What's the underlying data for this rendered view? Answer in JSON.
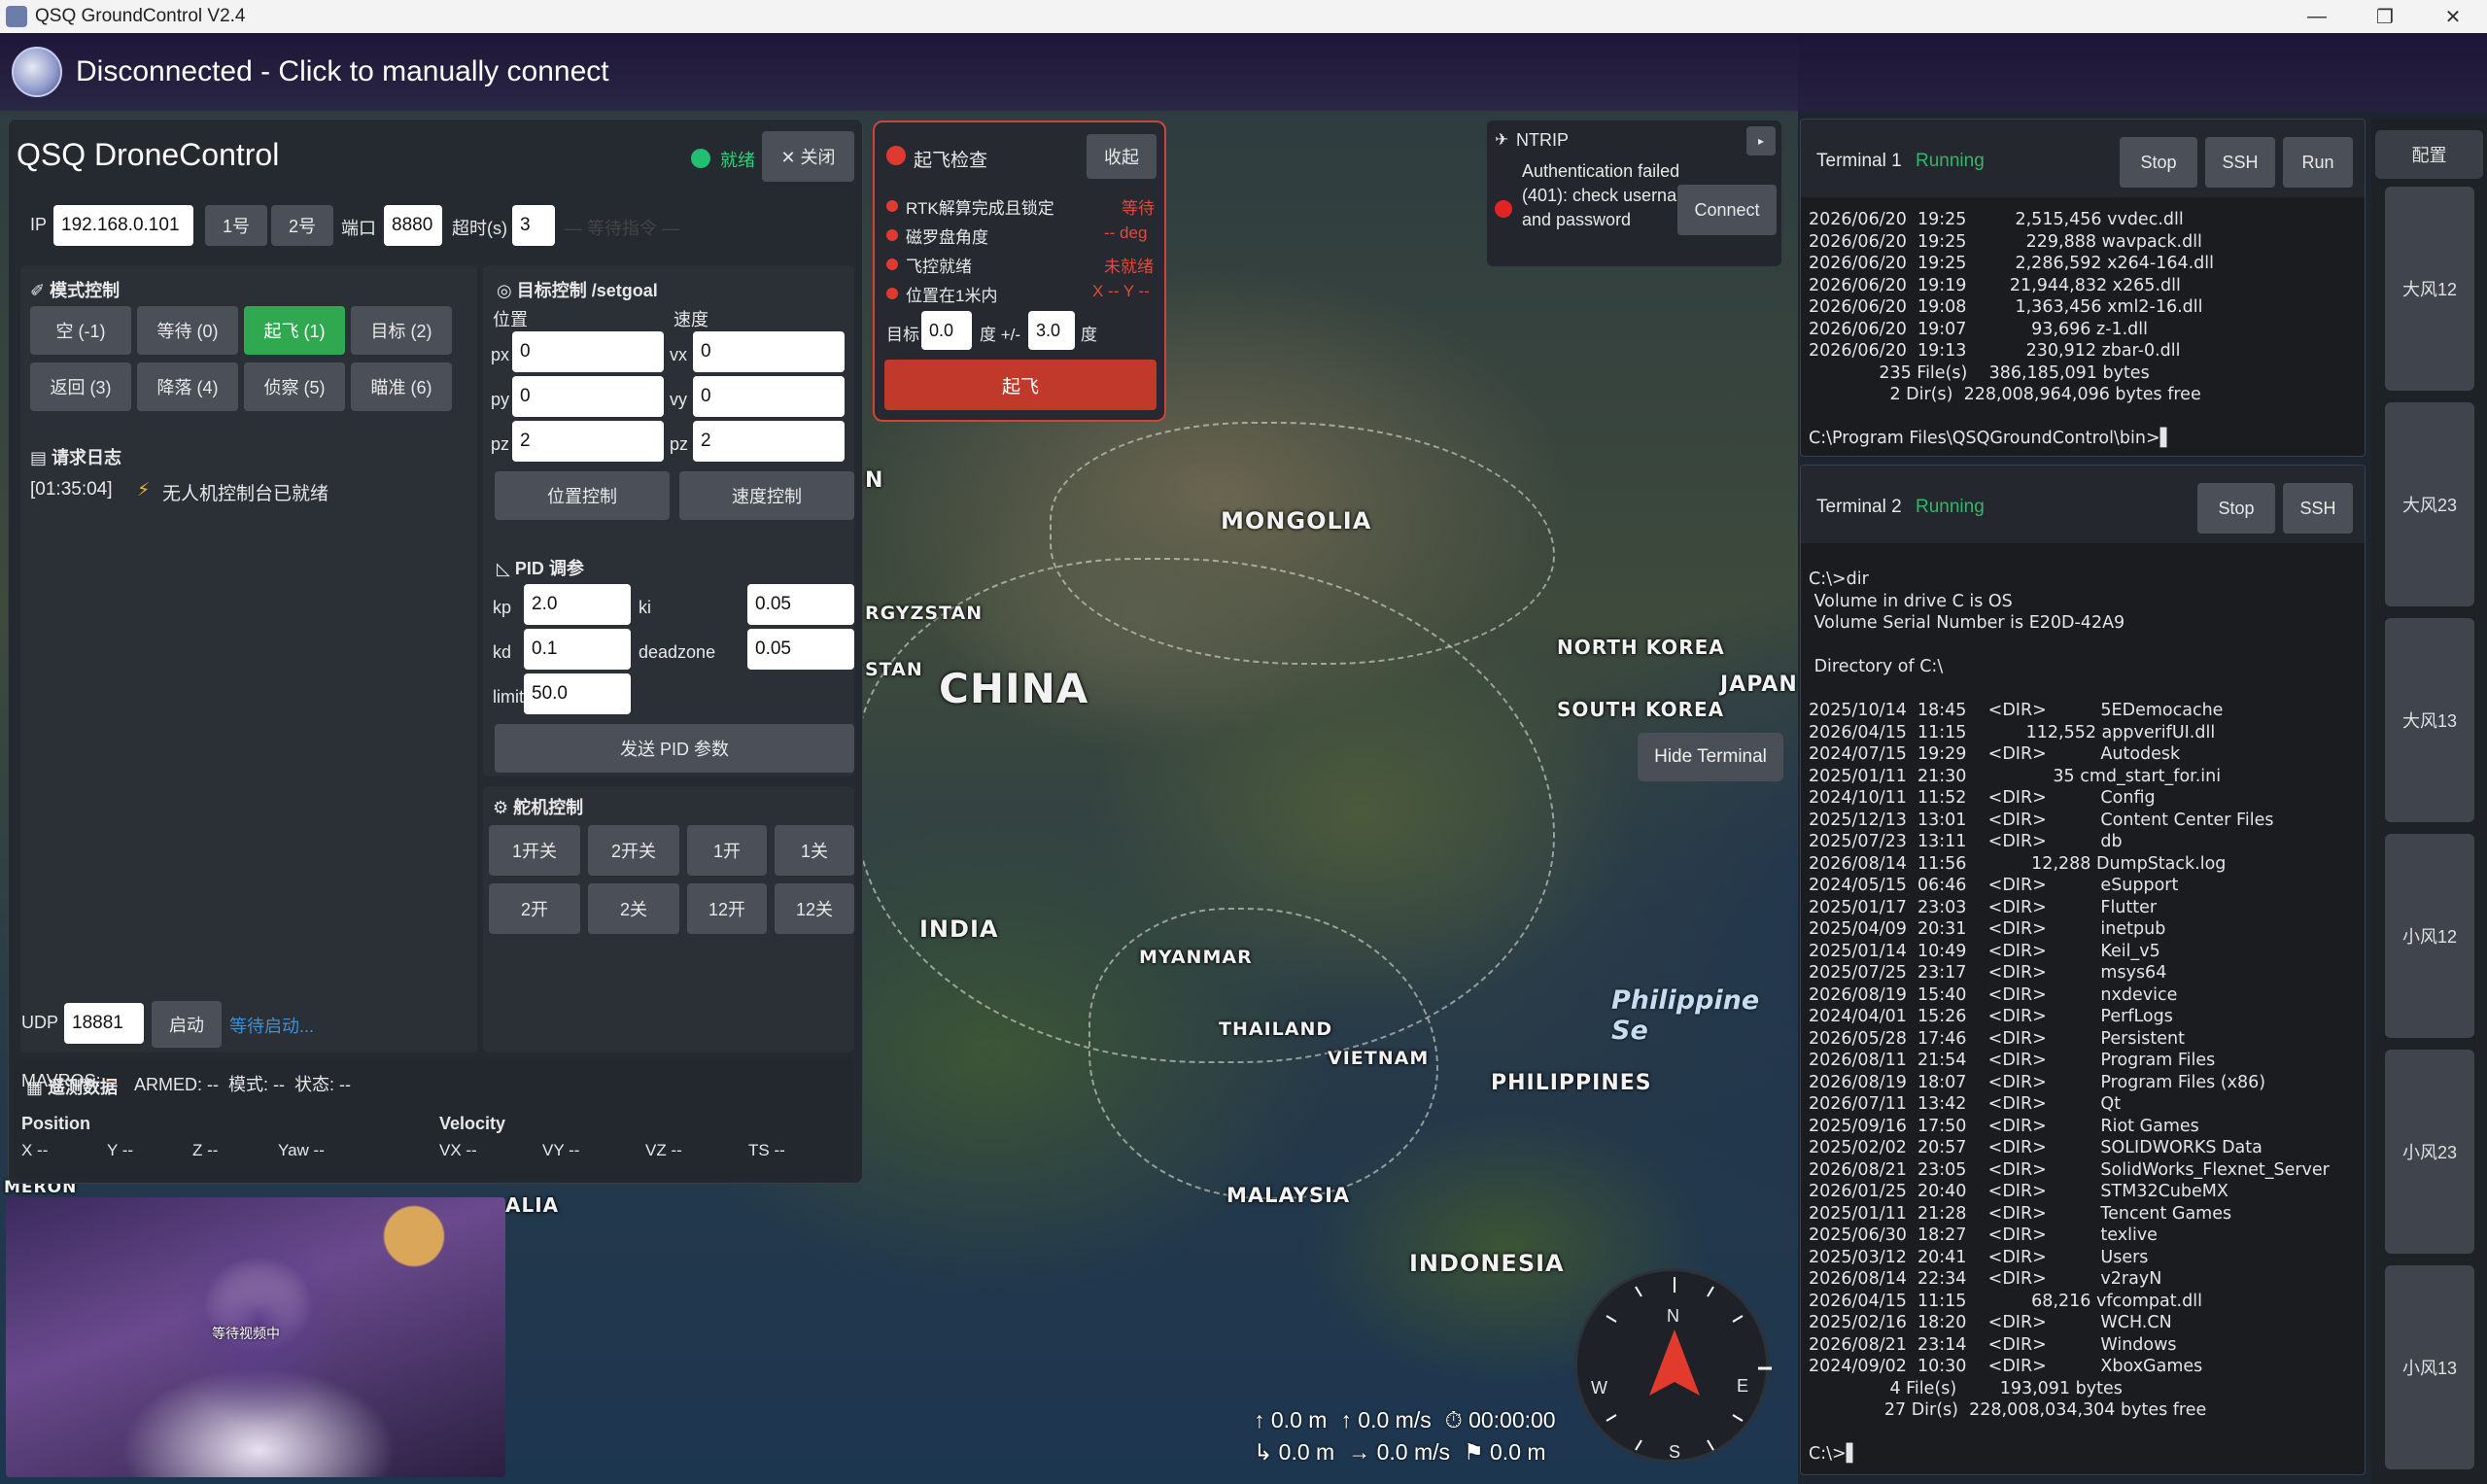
{
  "window": {
    "title": "QSQ GroundControl V2.4",
    "minimize": "—",
    "maximize": "❐",
    "close": "✕"
  },
  "banner": {
    "status": "Disconnected - Click to manually connect"
  },
  "map": {
    "labels": [
      "MONGOLIA",
      "CHINA",
      "NORTH KOREA",
      "SOUTH KOREA",
      "JAPAN",
      "INDIA",
      "MYANMAR",
      "THAILAND",
      "VIETNAM",
      "PHILIPPINES",
      "MALAYSIA",
      "INDONESIA",
      "RGYZSTAN",
      "STAN",
      "N",
      "ALIA",
      "MERON"
    ],
    "sea": "Philippine Se"
  },
  "drone_control": {
    "title": "QSQ DroneControl",
    "status": "就绪",
    "close_label": "✕ 关闭",
    "ip_label": "IP",
    "ip_value": "192.168.0.101",
    "drone1": "1号",
    "drone2": "2号",
    "port_label": "端口",
    "port_value": "8880",
    "timeout_label": "超时(s)",
    "timeout_value": "3",
    "waiting_cmd": "— 等待指令 —",
    "mode_section": "模式控制",
    "modes": [
      "空 (-1)",
      "等待 (0)",
      "起飞 (1)",
      "目标 (2)",
      "返回 (3)",
      "降落 (4)",
      "侦察 (5)",
      "瞄准 (6)"
    ],
    "log_section": "请求日志",
    "log_time": "[01:35:04]",
    "log_text": "无人机控制台已就绪",
    "target_section": "目标控制 /setgoal",
    "pos_label": "位置",
    "vel_label": "速度",
    "px_label": "px",
    "px_value": "0",
    "py_label": "py",
    "py_value": "0",
    "pz_label": "pz",
    "pz_value": "2",
    "vx_label": "vx",
    "vx_value": "0",
    "vy_label": "vy",
    "vy_value": "0",
    "vz_label": "pz",
    "vz_value": "2",
    "pos_ctrl": "位置控制",
    "vel_ctrl": "速度控制",
    "pid_section": "PID 调参",
    "kp_label": "kp",
    "kp_value": "2.0",
    "ki_label": "ki",
    "ki_value": "0.05",
    "kd_label": "kd",
    "kd_value": "0.1",
    "dz_label": "deadzone",
    "dz_value": "0.05",
    "limit_label": "limit",
    "limit_value": "50.0",
    "send_pid": "发送 PID 参数",
    "servo_section": "舵机控制",
    "servos": [
      "1开关",
      "2开关",
      "1开",
      "1关",
      "2开",
      "2关",
      "12开",
      "12关"
    ],
    "telemetry_section": "遥测数据",
    "udp_label": "UDP",
    "udp_value": "18881",
    "start_btn": "启动",
    "waiting_start": "等待启动...",
    "status_line_mavros": "MAVROS:",
    "status_line_mavros_val": "--",
    "status_line_rest": "ARMED: --  模式: --  状态: --",
    "position_head": "Position",
    "velocity_head": "Velocity",
    "pos_vals": [
      "X --",
      "Y --",
      "Z --",
      "Yaw --"
    ],
    "vel_vals": [
      "VX --",
      "VY --",
      "VZ --",
      "TS --"
    ]
  },
  "takeoff": {
    "title": "起飞检查",
    "collapse": "收起",
    "checks": [
      {
        "label": "RTK解算完成且锁定",
        "status": "等待"
      },
      {
        "label": "磁罗盘角度",
        "status": "-- deg"
      },
      {
        "label": "飞控就绪",
        "status": "未就绪"
      },
      {
        "label": "位置在1米内",
        "status": "X -- Y --"
      }
    ],
    "target_label": "目标",
    "target_value": "0.0",
    "deg_pm": "度 +/-",
    "tol_value": "3.0",
    "deg": "度",
    "takeoff_btn": "起飞"
  },
  "ntrip": {
    "title": "NTRIP",
    "message": "Authentication failed (401): check username and password",
    "connect": "Connect",
    "status_color": "#e02424"
  },
  "terminal1": {
    "title": "Terminal 1",
    "state": "Running",
    "buttons": [
      "Stop",
      "SSH",
      "Run"
    ],
    "lines": [
      "2026/06/20  19:25         2,515,456 vvdec.dll",
      "2026/06/20  19:25           229,888 wavpack.dll",
      "2026/06/20  19:25         2,286,592 x264-164.dll",
      "2026/06/20  19:19        21,944,832 x265.dll",
      "2026/06/20  19:08         1,363,456 xml2-16.dll",
      "2026/06/20  19:07            93,696 z-1.dll",
      "2026/06/20  19:13           230,912 zbar-0.dll",
      "             235 File(s)    386,185,091 bytes",
      "               2 Dir(s)  228,008,964,096 bytes free",
      "",
      "C:\\Program Files\\QSQGroundControl\\bin>▌"
    ]
  },
  "terminal2": {
    "title": "Terminal 2",
    "state": "Running",
    "buttons": [
      "Stop",
      "SSH"
    ],
    "lines": [
      "C:\\>dir",
      " Volume in drive C is OS",
      " Volume Serial Number is E20D-42A9",
      "",
      " Directory of C:\\",
      "",
      "2025/10/14  18:45    <DIR>          5EDemocache",
      "2026/04/15  11:15           112,552 appverifUI.dll",
      "2024/07/15  19:29    <DIR>          Autodesk",
      "2025/01/11  21:30                35 cmd_start_for.ini",
      "2024/10/11  11:52    <DIR>          Config",
      "2025/12/13  13:01    <DIR>          Content Center Files",
      "2025/07/23  13:11    <DIR>          db",
      "2026/08/14  11:56            12,288 DumpStack.log",
      "2024/05/15  06:46    <DIR>          eSupport",
      "2025/01/17  23:03    <DIR>          Flutter",
      "2025/04/09  20:31    <DIR>          inetpub",
      "2025/01/14  10:49    <DIR>          Keil_v5",
      "2025/07/25  23:17    <DIR>          msys64",
      "2026/08/19  15:40    <DIR>          nxdevice",
      "2024/04/01  15:26    <DIR>          PerfLogs",
      "2026/05/28  17:46    <DIR>          Persistent",
      "2026/08/11  21:54    <DIR>          Program Files",
      "2026/08/19  18:07    <DIR>          Program Files (x86)",
      "2026/07/11  13:42    <DIR>          Qt",
      "2025/09/16  17:50    <DIR>          Riot Games",
      "2025/02/02  20:57    <DIR>          SOLIDWORKS Data",
      "2026/08/21  23:05    <DIR>          SolidWorks_Flexnet_Server",
      "2026/01/25  20:40    <DIR>          STM32CubeMX",
      "2025/01/11  21:28    <DIR>          Tencent Games",
      "2025/06/30  18:27    <DIR>          texlive",
      "2025/03/12  20:41    <DIR>          Users",
      "2026/08/14  22:34    <DIR>          v2rayN",
      "2026/04/15  11:15            68,216 vfcompat.dll",
      "2025/02/16  18:20    <DIR>          WCH.CN",
      "2026/08/21  23:14    <DIR>          Windows",
      "2024/09/02  10:30    <DIR>          XboxGames",
      "               4 File(s)        193,091 bytes",
      "              27 Dir(s)  228,008,034,304 bytes free",
      "",
      "C:\\>▌"
    ]
  },
  "hide_terminal": "Hide Terminal",
  "config": {
    "title": "配置",
    "items": [
      "大风12",
      "大风23",
      "大风13",
      "小风12",
      "小风23",
      "小风13"
    ]
  },
  "video": {
    "caption": "等待视频中"
  },
  "compass": {
    "n": "N",
    "s": "S",
    "e": "E",
    "w": "W"
  },
  "hud": {
    "alt": "↑ 0.0 m",
    "vspeed": "↑ 0.0 m/s",
    "time": "⏱ 00:00:00",
    "dist": "↳ 0.0 m",
    "hspeed": "→ 0.0 m/s",
    "home": "⚑ 0.0 m"
  },
  "colors": {
    "green": "#2fa84f",
    "red": "#c0392b",
    "accent_running": "#35b56a",
    "link_blue": "#3d8fd6"
  }
}
